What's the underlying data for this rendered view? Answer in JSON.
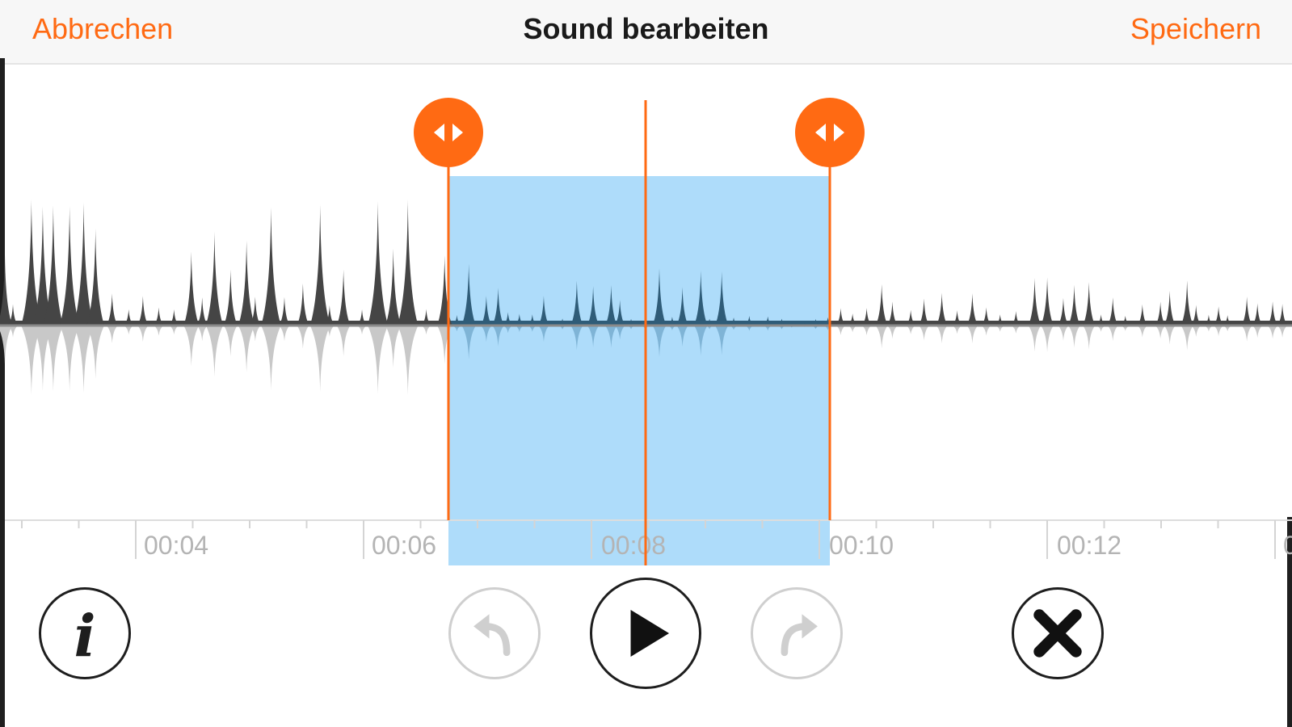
{
  "header": {
    "cancel_label": "Abbrechen",
    "title": "Sound bearbeiten",
    "save_label": "Speichern"
  },
  "timeline": {
    "tick_labels": [
      "00:04",
      "00:06",
      "00:08",
      "00:10",
      "00:12",
      "0"
    ]
  },
  "controls": {
    "info_icon": "info-icon",
    "undo_icon": "undo-icon",
    "play_icon": "play-icon",
    "redo_icon": "redo-icon",
    "close_icon": "close-icon"
  },
  "colors": {
    "accent": "#ff6a13",
    "selection": "#aedcfa",
    "waveform": "#454545",
    "waveform_mirror": "#c8c8c8",
    "waveform_selected": "#2f5c78",
    "waveform_selected_mirror": "#7fb4d6"
  }
}
